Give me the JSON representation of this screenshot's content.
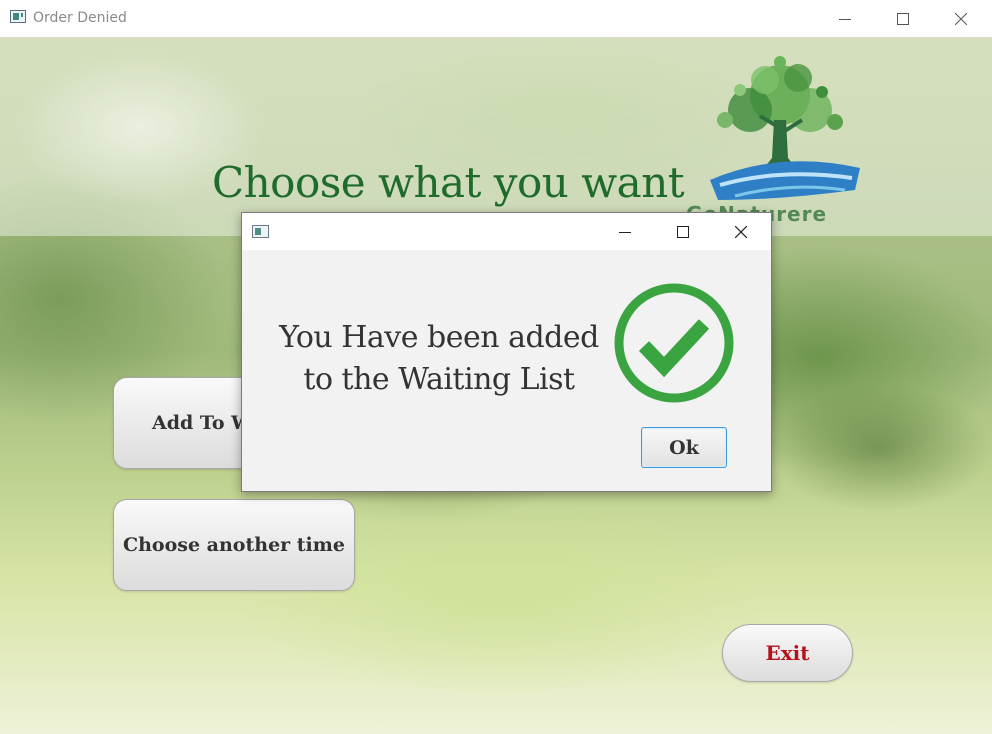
{
  "window": {
    "title": "Order Denied"
  },
  "main": {
    "heading": "Choose what you want",
    "logo_text": "GoNaturere",
    "buttons": {
      "add_waiting": "Add To Waiting List",
      "choose_time": "Choose another time",
      "exit": "Exit"
    }
  },
  "dialog": {
    "title": "",
    "message_line1": "You Have been added",
    "message_line2": "to the Waiting List",
    "ok_label": "Ok"
  },
  "colors": {
    "heading": "#1f6b2c",
    "exit_text": "#b3141b",
    "check_green": "#3aa540",
    "ok_border": "#3b9ad9"
  }
}
